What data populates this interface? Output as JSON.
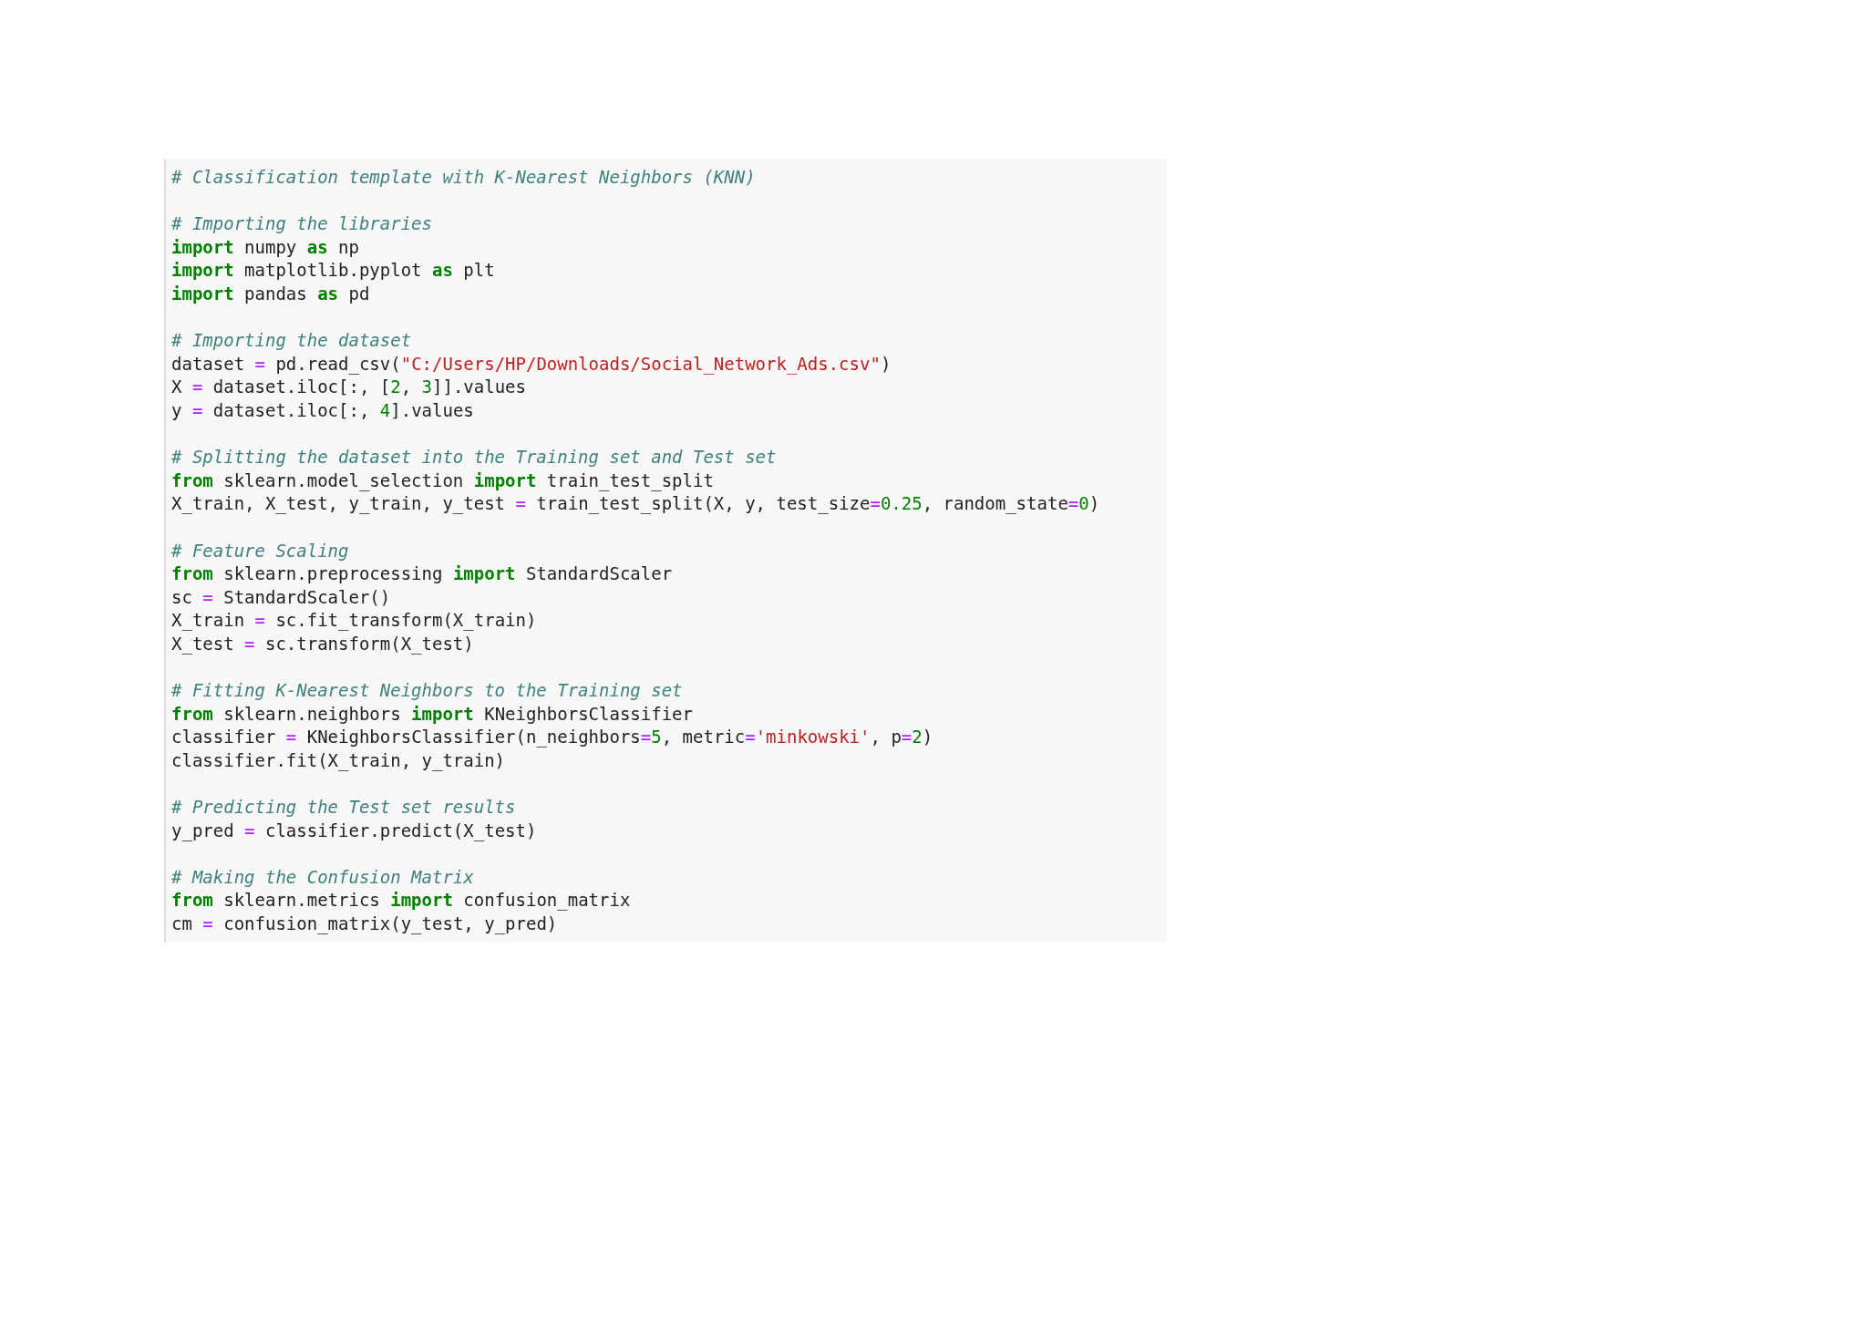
{
  "code_cell": {
    "lines": [
      {
        "kind": "code",
        "tokens": [
          {
            "kind": "comment",
            "text": "# Classification template with K-Nearest Neighbors (KNN)"
          }
        ]
      },
      {
        "kind": "blank"
      },
      {
        "kind": "code",
        "tokens": [
          {
            "kind": "comment",
            "text": "# Importing the libraries"
          }
        ]
      },
      {
        "kind": "code",
        "tokens": [
          {
            "kind": "keyword",
            "text": "import"
          },
          {
            "kind": "text",
            "text": " numpy "
          },
          {
            "kind": "keyword",
            "text": "as"
          },
          {
            "kind": "text",
            "text": " np"
          }
        ]
      },
      {
        "kind": "code",
        "tokens": [
          {
            "kind": "keyword",
            "text": "import"
          },
          {
            "kind": "text",
            "text": " matplotlib.pyplot "
          },
          {
            "kind": "keyword",
            "text": "as"
          },
          {
            "kind": "text",
            "text": " plt"
          }
        ]
      },
      {
        "kind": "code",
        "tokens": [
          {
            "kind": "keyword",
            "text": "import"
          },
          {
            "kind": "text",
            "text": " pandas "
          },
          {
            "kind": "keyword",
            "text": "as"
          },
          {
            "kind": "text",
            "text": " pd"
          }
        ]
      },
      {
        "kind": "blank"
      },
      {
        "kind": "code",
        "tokens": [
          {
            "kind": "comment",
            "text": "# Importing the dataset"
          }
        ]
      },
      {
        "kind": "code",
        "tokens": [
          {
            "kind": "text",
            "text": "dataset "
          },
          {
            "kind": "operator",
            "text": "="
          },
          {
            "kind": "text",
            "text": " pd.read_csv("
          },
          {
            "kind": "string",
            "text": "\"C:/Users/HP/Downloads/Social_Network_Ads.csv\""
          },
          {
            "kind": "text",
            "text": ")"
          }
        ]
      },
      {
        "kind": "code",
        "tokens": [
          {
            "kind": "text",
            "text": "X "
          },
          {
            "kind": "operator",
            "text": "="
          },
          {
            "kind": "text",
            "text": " dataset.iloc[:, ["
          },
          {
            "kind": "number",
            "text": "2"
          },
          {
            "kind": "text",
            "text": ", "
          },
          {
            "kind": "number",
            "text": "3"
          },
          {
            "kind": "text",
            "text": "]].values"
          }
        ]
      },
      {
        "kind": "code",
        "tokens": [
          {
            "kind": "text",
            "text": "y "
          },
          {
            "kind": "operator",
            "text": "="
          },
          {
            "kind": "text",
            "text": " dataset.iloc[:, "
          },
          {
            "kind": "number",
            "text": "4"
          },
          {
            "kind": "text",
            "text": "].values"
          }
        ]
      },
      {
        "kind": "blank"
      },
      {
        "kind": "code",
        "tokens": [
          {
            "kind": "comment",
            "text": "# Splitting the dataset into the Training set and Test set"
          }
        ]
      },
      {
        "kind": "code",
        "tokens": [
          {
            "kind": "keyword",
            "text": "from"
          },
          {
            "kind": "text",
            "text": " sklearn.model_selection "
          },
          {
            "kind": "keyword",
            "text": "import"
          },
          {
            "kind": "text",
            "text": " train_test_split"
          }
        ]
      },
      {
        "kind": "code",
        "tokens": [
          {
            "kind": "text",
            "text": "X_train, X_test, y_train, y_test "
          },
          {
            "kind": "operator",
            "text": "="
          },
          {
            "kind": "text",
            "text": " train_test_split(X, y, test_size"
          },
          {
            "kind": "operator",
            "text": "="
          },
          {
            "kind": "number",
            "text": "0.25"
          },
          {
            "kind": "text",
            "text": ", random_state"
          },
          {
            "kind": "operator",
            "text": "="
          },
          {
            "kind": "number",
            "text": "0"
          },
          {
            "kind": "text",
            "text": ")"
          }
        ]
      },
      {
        "kind": "blank"
      },
      {
        "kind": "code",
        "tokens": [
          {
            "kind": "comment",
            "text": "# Feature Scaling"
          }
        ]
      },
      {
        "kind": "code",
        "tokens": [
          {
            "kind": "keyword",
            "text": "from"
          },
          {
            "kind": "text",
            "text": " sklearn.preprocessing "
          },
          {
            "kind": "keyword",
            "text": "import"
          },
          {
            "kind": "text",
            "text": " StandardScaler"
          }
        ]
      },
      {
        "kind": "code",
        "tokens": [
          {
            "kind": "text",
            "text": "sc "
          },
          {
            "kind": "operator",
            "text": "="
          },
          {
            "kind": "text",
            "text": " StandardScaler()"
          }
        ]
      },
      {
        "kind": "code",
        "tokens": [
          {
            "kind": "text",
            "text": "X_train "
          },
          {
            "kind": "operator",
            "text": "="
          },
          {
            "kind": "text",
            "text": " sc.fit_transform(X_train)"
          }
        ]
      },
      {
        "kind": "code",
        "tokens": [
          {
            "kind": "text",
            "text": "X_test "
          },
          {
            "kind": "operator",
            "text": "="
          },
          {
            "kind": "text",
            "text": " sc.transform(X_test)"
          }
        ]
      },
      {
        "kind": "blank"
      },
      {
        "kind": "code",
        "tokens": [
          {
            "kind": "comment",
            "text": "# Fitting K-Nearest Neighbors to the Training set"
          }
        ]
      },
      {
        "kind": "code",
        "tokens": [
          {
            "kind": "keyword",
            "text": "from"
          },
          {
            "kind": "text",
            "text": " sklearn.neighbors "
          },
          {
            "kind": "keyword",
            "text": "import"
          },
          {
            "kind": "text",
            "text": " KNeighborsClassifier"
          }
        ]
      },
      {
        "kind": "code",
        "tokens": [
          {
            "kind": "text",
            "text": "classifier "
          },
          {
            "kind": "operator",
            "text": "="
          },
          {
            "kind": "text",
            "text": " KNeighborsClassifier(n_neighbors"
          },
          {
            "kind": "operator",
            "text": "="
          },
          {
            "kind": "number",
            "text": "5"
          },
          {
            "kind": "text",
            "text": ", metric"
          },
          {
            "kind": "operator",
            "text": "="
          },
          {
            "kind": "string",
            "text": "'minkowski'"
          },
          {
            "kind": "text",
            "text": ", p"
          },
          {
            "kind": "operator",
            "text": "="
          },
          {
            "kind": "number",
            "text": "2"
          },
          {
            "kind": "text",
            "text": ")"
          }
        ]
      },
      {
        "kind": "code",
        "tokens": [
          {
            "kind": "text",
            "text": "classifier.fit(X_train, y_train)"
          }
        ]
      },
      {
        "kind": "blank"
      },
      {
        "kind": "code",
        "tokens": [
          {
            "kind": "comment",
            "text": "# Predicting the Test set results"
          }
        ]
      },
      {
        "kind": "code",
        "tokens": [
          {
            "kind": "text",
            "text": "y_pred "
          },
          {
            "kind": "operator",
            "text": "="
          },
          {
            "kind": "text",
            "text": " classifier.predict(X_test)"
          }
        ]
      },
      {
        "kind": "blank"
      },
      {
        "kind": "code",
        "tokens": [
          {
            "kind": "comment",
            "text": "# Making the Confusion Matrix"
          }
        ]
      },
      {
        "kind": "code",
        "tokens": [
          {
            "kind": "keyword",
            "text": "from"
          },
          {
            "kind": "text",
            "text": " sklearn.metrics "
          },
          {
            "kind": "keyword",
            "text": "import"
          },
          {
            "kind": "text",
            "text": " confusion_matrix"
          }
        ]
      },
      {
        "kind": "code",
        "tokens": [
          {
            "kind": "text",
            "text": "cm "
          },
          {
            "kind": "operator",
            "text": "="
          },
          {
            "kind": "text",
            "text": " confusion_matrix(y_test, y_pred)"
          }
        ]
      }
    ]
  }
}
